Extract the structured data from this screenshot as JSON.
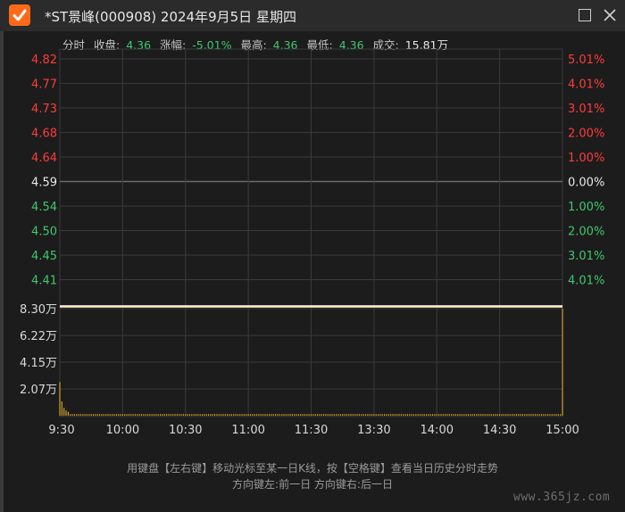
{
  "window": {
    "title": "*ST景峰(000908) 2024年9月5日 星期四",
    "icon": "check-icon",
    "buttons": [
      "maximize-icon",
      "close-icon"
    ]
  },
  "info": {
    "mode": "分时",
    "close_label": "收盘:",
    "close_value": "4.36",
    "change_label": "涨幅:",
    "change_value": "-5.01%",
    "high_label": "最高:",
    "high_value": "4.36",
    "low_label": "最低:",
    "low_value": "4.36",
    "volume_label": "成交:",
    "volume_value": "15.81万"
  },
  "colors": {
    "up": "#ff3b3b",
    "down": "#3ec76e",
    "flat": "#e8e8e8",
    "price_line": "#ffffff",
    "avg_line": "#e0c080",
    "volume": "#d2a030",
    "grid": "#3a3a3a"
  },
  "chart_data": {
    "type": "line",
    "price_axis": {
      "labels": [
        "4.82",
        "4.77",
        "4.73",
        "4.68",
        "4.64",
        "4.59",
        "4.54",
        "4.50",
        "4.45",
        "4.41"
      ],
      "values": [
        4.82,
        4.77,
        4.73,
        4.68,
        4.64,
        4.59,
        4.54,
        4.5,
        4.45,
        4.41
      ],
      "percent_labels": [
        "5.01%",
        "4.01%",
        "3.01%",
        "2.00%",
        "1.00%",
        "0.00%",
        "1.00%",
        "2.00%",
        "3.01%",
        "4.01%"
      ],
      "prev_close": 4.59
    },
    "volume_axis": {
      "labels": [
        "8.30万",
        "6.22万",
        "4.15万",
        "2.07万"
      ],
      "values": [
        8.3,
        6.22,
        4.15,
        2.07
      ],
      "unit": "万"
    },
    "time_labels": [
      "9:30",
      "10:00",
      "10:30",
      "11:00",
      "11:30",
      "13:30",
      "14:00",
      "14:30",
      "15:00"
    ],
    "price_series": {
      "x": [
        0,
        240
      ],
      "y": [
        4.36,
        4.36
      ]
    },
    "volume_series": {
      "opening_bars": [
        2.6,
        1.1,
        0.6,
        0.4,
        0.3
      ],
      "baseline_bar": 0.12,
      "closing_bar": 8.3,
      "minutes": 241
    }
  },
  "footer": {
    "line1": "用键盘【左右键】移动光标至某一日K线，按【空格键】查看当日历史分时走势",
    "line2": "方向键左:前一日    方向键右:后一日"
  },
  "watermark": "www.365jz.com"
}
